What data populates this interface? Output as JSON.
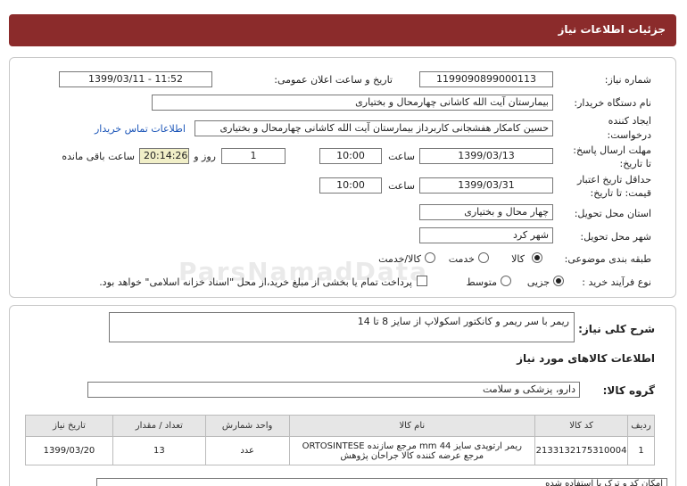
{
  "header": {
    "title": "جزئیات اطلاعات نیاز"
  },
  "fields": {
    "need_number_label": "شماره نیاز:",
    "need_number": "1199090899000113",
    "announce_label": "تاریخ و ساعت اعلان عمومی:",
    "announce_value": "1399/03/11 - 11:52",
    "buyer_label": "نام دستگاه خریدار:",
    "buyer_value": "بیمارستان آیت الله کاشانی چهارمحال و بختیاری",
    "creator_label_1": "ایجاد کننده",
    "creator_label_2": "درخواست:",
    "creator_value": "حسین کامکار هفشجانی کاربرداز بیمارستان آیت الله کاشانی چهارمحال و بختیاری",
    "contact_link": "اطلاعات تماس خریدار",
    "deadline_label_1": "مهلت ارسال پاسخ:",
    "deadline_label_2": "تا تاریخ:",
    "deadline_date": "1399/03/13",
    "time_label": "ساعت",
    "deadline_time": "10:00",
    "days_value": "1",
    "days_label": "روز و",
    "remaining_time": "20:14:26",
    "remaining_label": "ساعت باقی مانده",
    "validity_label_1": "حداقل تاریخ اعتبار",
    "validity_label_2": "قیمت: تا تاریخ:",
    "validity_date": "1399/03/31",
    "validity_time": "10:00",
    "province_label": "استان محل تحویل:",
    "province_value": "چهار محال و بختیاری",
    "city_label": "شهر محل تحویل:",
    "city_value": "شهر کرد",
    "category_label": "طبقه بندی موضوعی:",
    "category_options": [
      "کالا",
      "خدمت",
      "کالا/خدمت"
    ],
    "process_label": "نوع فرآیند خرید :",
    "process_options": [
      "جزیی",
      "متوسط"
    ],
    "payment_note": "پرداخت تمام یا بخشی از مبلغ خرید،از محل \"اسناد خزانه اسلامی\" خواهد بود."
  },
  "watermark": "ParsNamadData",
  "summary": {
    "label": "شرح کلی نیاز:",
    "value": "ریمر با سر ریمر و کانکتور اسکولاپ از سایز 8 تا 14"
  },
  "goods_info_title": "اطلاعات کالاهای مورد نیاز",
  "goods_group": {
    "label": "گروه کالا:",
    "value": "دارو، پزشکی و سلامت"
  },
  "table": {
    "headers": [
      "ردیف",
      "کد کالا",
      "نام کالا",
      "واحد شمارش",
      "تعداد / مقدار",
      "تاریخ نیاز"
    ],
    "rows": [
      {
        "index": "1",
        "code": "2133132175310004",
        "name_1": "ریمر ارتوپدی سایز 44 mm مرجع سازنده ORTOSINTESE",
        "name_2": "مرجع عرضه کننده کالا جراحان پژوهش",
        "unit": "عدد",
        "qty": "13",
        "date": "1399/03/20"
      }
    ]
  },
  "bottom_note": "امکان کد و ترک با استفاده شده"
}
